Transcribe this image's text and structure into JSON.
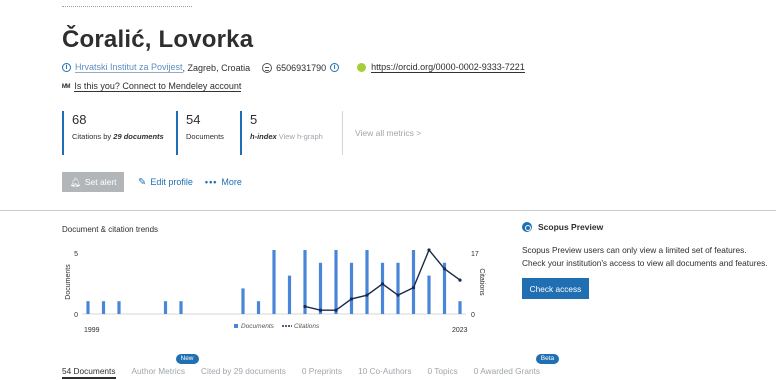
{
  "author": {
    "name": "Čoralić, Lovorka",
    "affiliation": "Hrvatski Institut za Povijest",
    "location": ", Zagreb, Croatia",
    "scopus_id": "6506931790",
    "orcid": "https://orcid.org/0000-0002-9333-7221",
    "mendeley": "Is this you? Connect to Mendeley account"
  },
  "metrics": {
    "citations": {
      "value": "68",
      "label_prefix": "Citations by ",
      "label_bold": "29 documents"
    },
    "documents": {
      "value": "54",
      "label": "Documents"
    },
    "h_index": {
      "value": "5",
      "label": "h-index",
      "link": "View h-graph"
    },
    "view_all": "View all metrics >"
  },
  "actions": {
    "set_alert": "Set alert",
    "edit_profile": "Edit profile",
    "more": "More"
  },
  "trends": {
    "title": "Document & citation trends"
  },
  "preview": {
    "title": "Scopus Preview",
    "text": "Scopus Preview users can only view a limited set of features. Check your institution's access to view all documents and features.",
    "button": "Check access"
  },
  "tabs": [
    {
      "label": "54 Documents"
    },
    {
      "label": "Author Metrics",
      "badge": "New"
    },
    {
      "label": "Cited by 29 documents"
    },
    {
      "label": "0 Preprints"
    },
    {
      "label": "10 Co-Authors"
    },
    {
      "label": "0 Topics"
    },
    {
      "label": "0 Awarded Grants",
      "badge": "Beta"
    }
  ],
  "colors": {
    "accent": "#1f6fb2",
    "bars": "#4a86d8",
    "line": "#1a2a4f",
    "muted": "#a0a6ab"
  },
  "chart_data": {
    "type": "bar",
    "categories": [
      "1999",
      "2000",
      "2001",
      "2002",
      "2003",
      "2004",
      "2005",
      "2006",
      "2007",
      "2008",
      "2009",
      "2010",
      "2011",
      "2012",
      "2013",
      "2014",
      "2015",
      "2016",
      "2017",
      "2018",
      "2019",
      "2020",
      "2021",
      "2022",
      "2023"
    ],
    "series": [
      {
        "name": "Documents",
        "type": "bar",
        "axis": "left",
        "values": [
          1,
          1,
          1,
          0,
          0,
          1,
          1,
          0,
          0,
          0,
          2,
          1,
          5,
          3,
          5,
          4,
          5,
          4,
          5,
          4,
          4,
          5,
          3,
          4,
          1
        ]
      },
      {
        "name": "Citations",
        "type": "line",
        "axis": "right",
        "values": [
          null,
          null,
          null,
          null,
          null,
          null,
          null,
          null,
          null,
          null,
          null,
          null,
          null,
          null,
          2,
          1,
          1,
          4,
          5,
          8,
          5,
          7,
          17,
          12,
          9
        ]
      }
    ],
    "xlabel": "",
    "ylabel": "Documents",
    "y2label": "Citations",
    "ylim": [
      0,
      5
    ],
    "y2lim": [
      0,
      17
    ],
    "x_tick_labels": [
      "1999",
      "2023"
    ],
    "y_tick_labels": [
      "0",
      "5"
    ],
    "y2_tick_labels": [
      "0",
      "17"
    ],
    "legend": "bottom-center",
    "grid": false
  }
}
